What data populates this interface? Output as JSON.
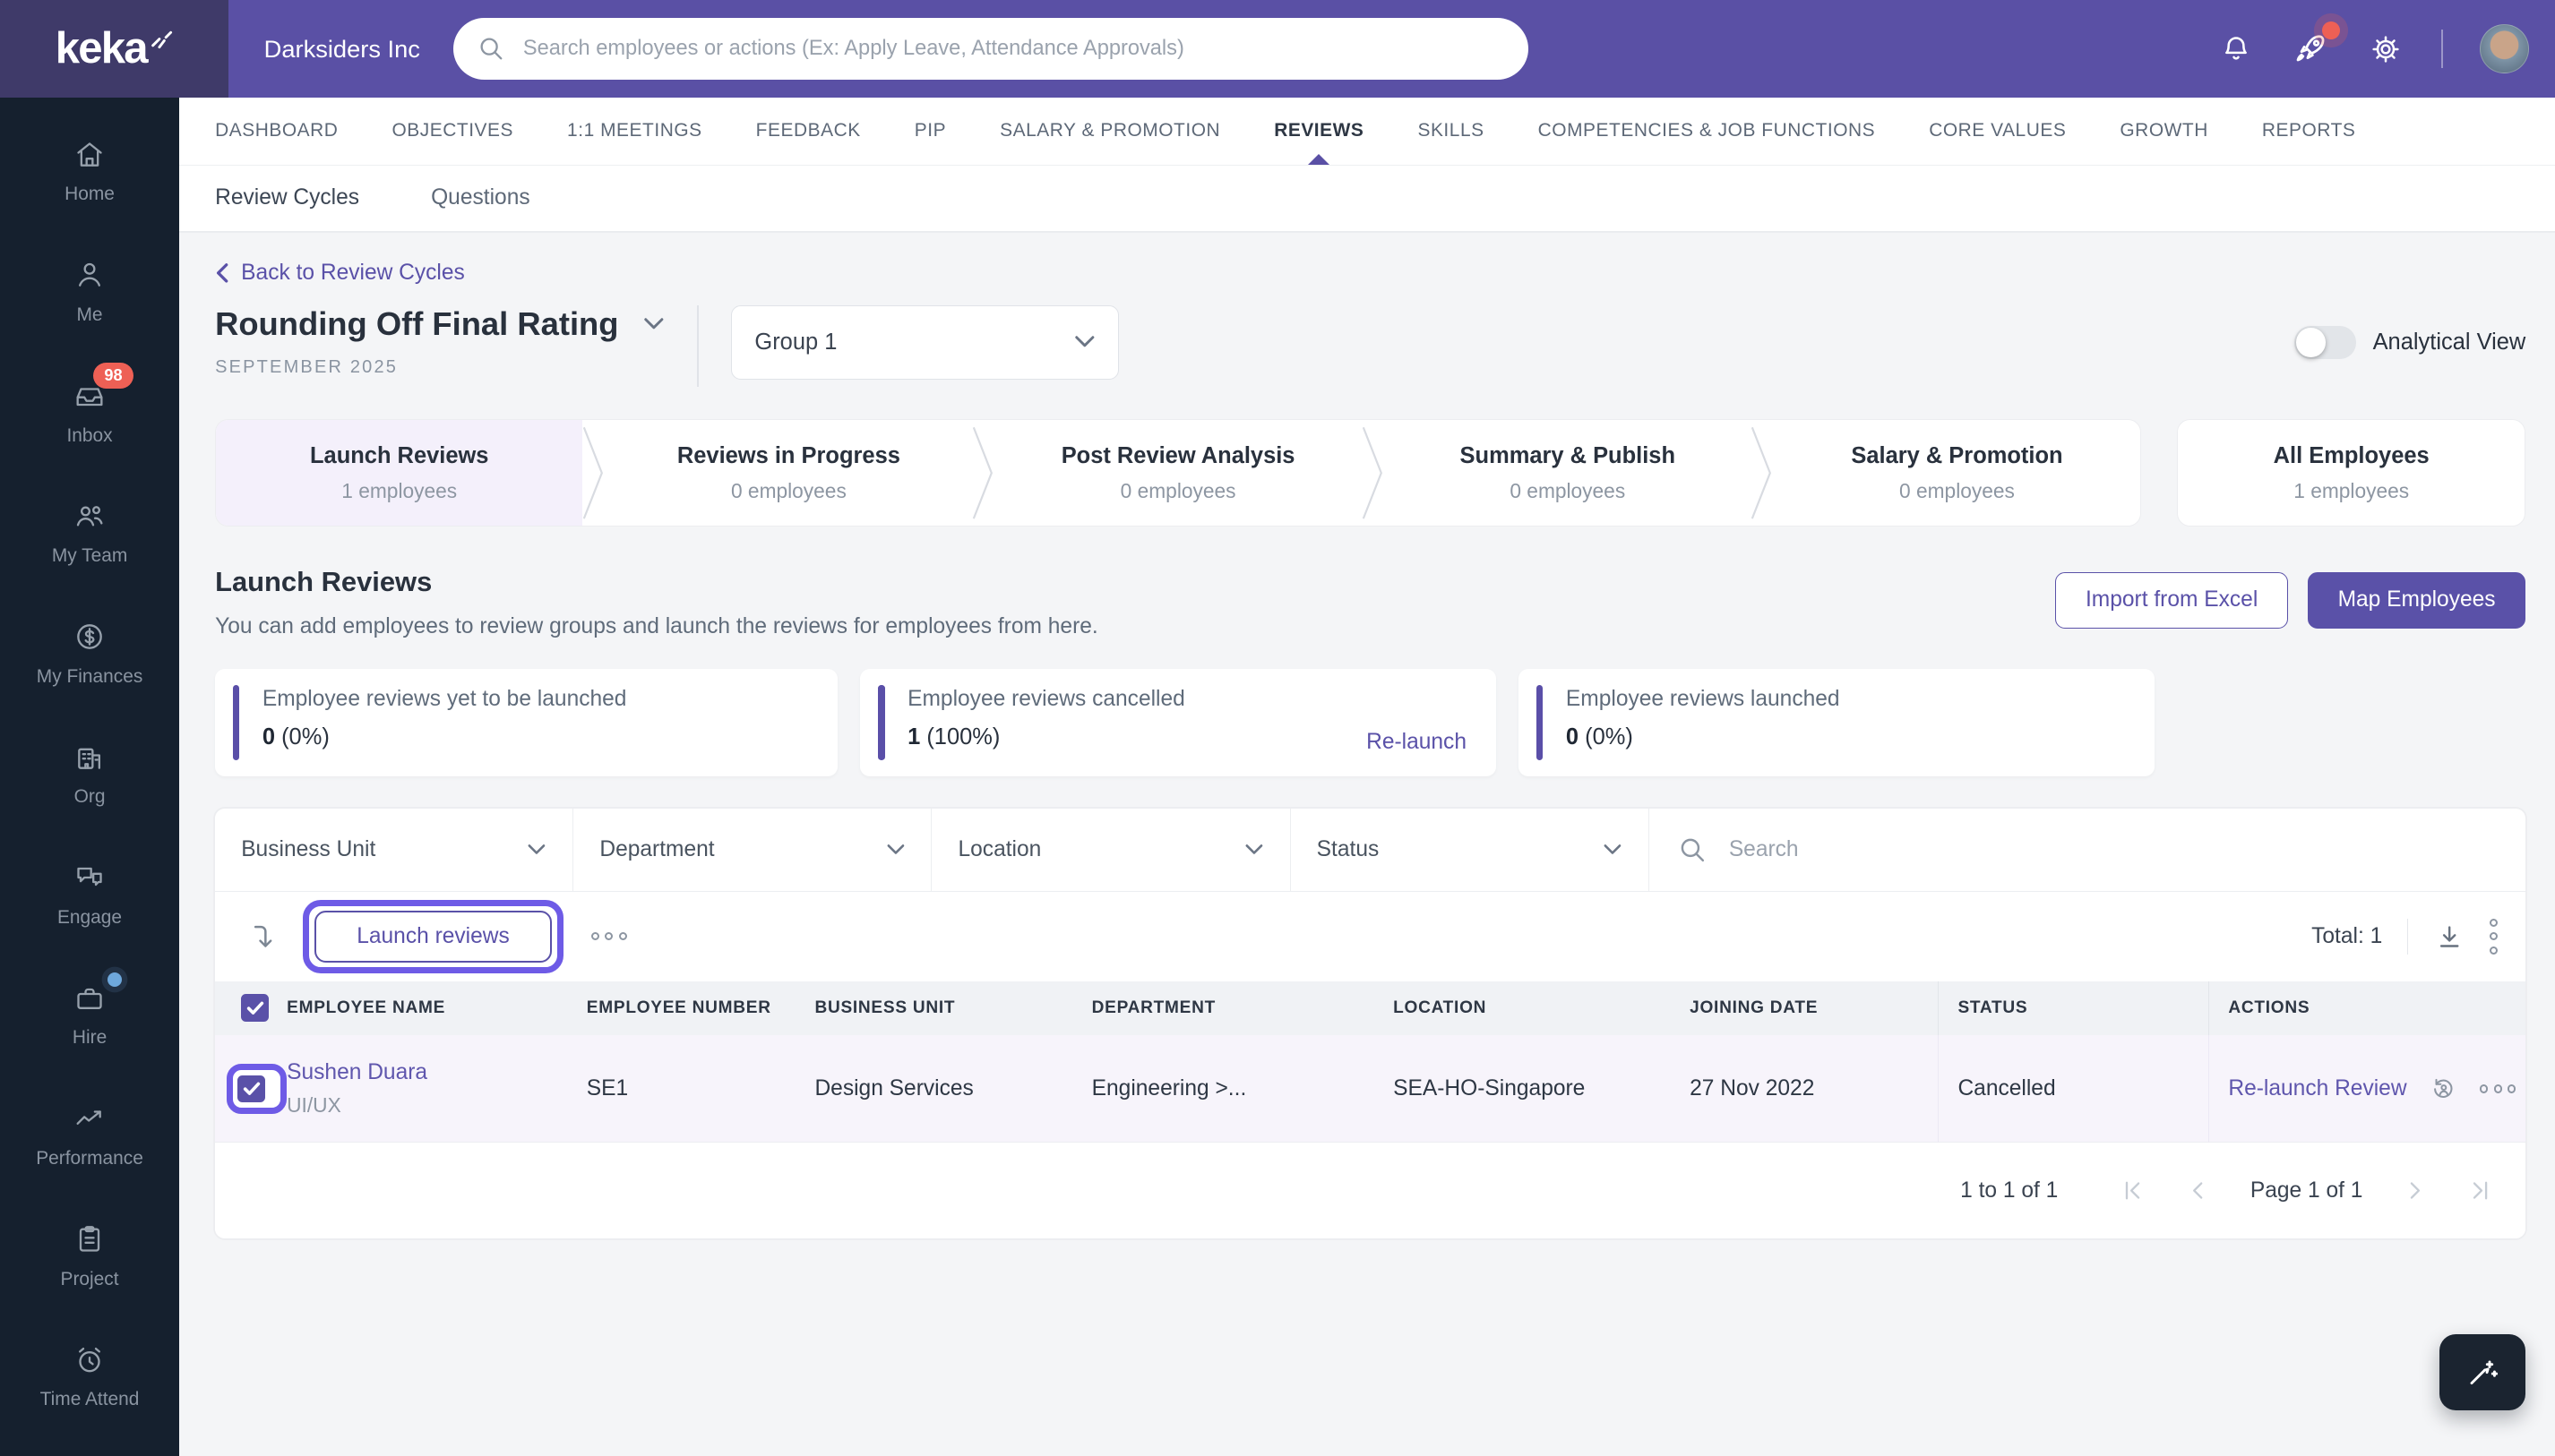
{
  "topbar": {
    "logo": "keka",
    "company": "Darksiders Inc",
    "search_placeholder": "Search employees or actions (Ex: Apply Leave, Attendance Approvals)"
  },
  "nav": {
    "tabs": [
      {
        "label": "DASHBOARD"
      },
      {
        "label": "OBJECTIVES"
      },
      {
        "label": "1:1 MEETINGS"
      },
      {
        "label": "FEEDBACK"
      },
      {
        "label": "PIP"
      },
      {
        "label": "SALARY & PROMOTION"
      },
      {
        "label": "REVIEWS",
        "active": true
      },
      {
        "label": "SKILLS"
      },
      {
        "label": "COMPETENCIES & JOB FUNCTIONS"
      },
      {
        "label": "CORE VALUES"
      },
      {
        "label": "GROWTH"
      },
      {
        "label": "REPORTS"
      }
    ]
  },
  "subnav": {
    "items": [
      {
        "label": "Review Cycles"
      },
      {
        "label": "Questions"
      }
    ]
  },
  "page": {
    "back_link": "Back to Review Cycles",
    "title": "Rounding Off Final Rating",
    "subtitle": "SEPTEMBER 2025",
    "group_select": "Group 1",
    "analytical_view_label": "Analytical View",
    "stepper": [
      {
        "label": "Launch Reviews",
        "count": "1 employees"
      },
      {
        "label": "Reviews in Progress",
        "count": "0 employees"
      },
      {
        "label": "Post Review Analysis",
        "count": "0 employees"
      },
      {
        "label": "Summary & Publish",
        "count": "0 employees"
      },
      {
        "label": "Salary & Promotion",
        "count": "0 employees"
      }
    ],
    "all_employees": {
      "label": "All Employees",
      "count": "1 employees"
    },
    "section": {
      "title": "Launch Reviews",
      "description": "You can add employees to review groups and launch the reviews for employees from here.",
      "import_button": "Import from Excel",
      "map_button": "Map Employees"
    },
    "stats": [
      {
        "title": "Employee reviews yet to be launched",
        "value": "0",
        "pct": "(0%)"
      },
      {
        "title": "Employee reviews cancelled",
        "value": "1",
        "pct": "(100%)",
        "link": "Re-launch"
      },
      {
        "title": "Employee reviews launched",
        "value": "0",
        "pct": "(0%)"
      }
    ],
    "filters": [
      {
        "label": "Business Unit"
      },
      {
        "label": "Department"
      },
      {
        "label": "Location"
      },
      {
        "label": "Status"
      }
    ],
    "filter_search_placeholder": "Search",
    "toolbar": {
      "launch_button": "Launch reviews",
      "total": "Total: 1"
    },
    "table": {
      "columns": [
        "EMPLOYEE NAME",
        "EMPLOYEE NUMBER",
        "BUSINESS UNIT",
        "DEPARTMENT",
        "LOCATION",
        "JOINING DATE",
        "STATUS",
        "ACTIONS"
      ],
      "rows": [
        {
          "name": "Sushen Duara",
          "role": "UI/UX",
          "number": "SE1",
          "business_unit": "Design Services",
          "department": "Engineering >...",
          "location": "SEA-HO-Singapore",
          "joining_date": "27 Nov 2022",
          "status": "Cancelled",
          "action": "Re-launch Review"
        }
      ]
    },
    "pagination": {
      "range": "1 to 1 of 1",
      "page": "Page 1 of 1"
    }
  },
  "sidebar": {
    "items": [
      {
        "label": "Home"
      },
      {
        "label": "Me"
      },
      {
        "label": "Inbox",
        "badge": "98"
      },
      {
        "label": "My Team"
      },
      {
        "label": "My Finances"
      },
      {
        "label": "Org"
      },
      {
        "label": "Engage"
      },
      {
        "label": "Hire"
      },
      {
        "label": "Performance"
      },
      {
        "label": "Project"
      },
      {
        "label": "Time Attend"
      }
    ]
  },
  "colors": {
    "accent": "#5a51a8",
    "highlight": "#6e5be6",
    "badge_red": "#ee6055",
    "topbar": "#5a50a5",
    "sidebar_bg": "#15202e"
  }
}
